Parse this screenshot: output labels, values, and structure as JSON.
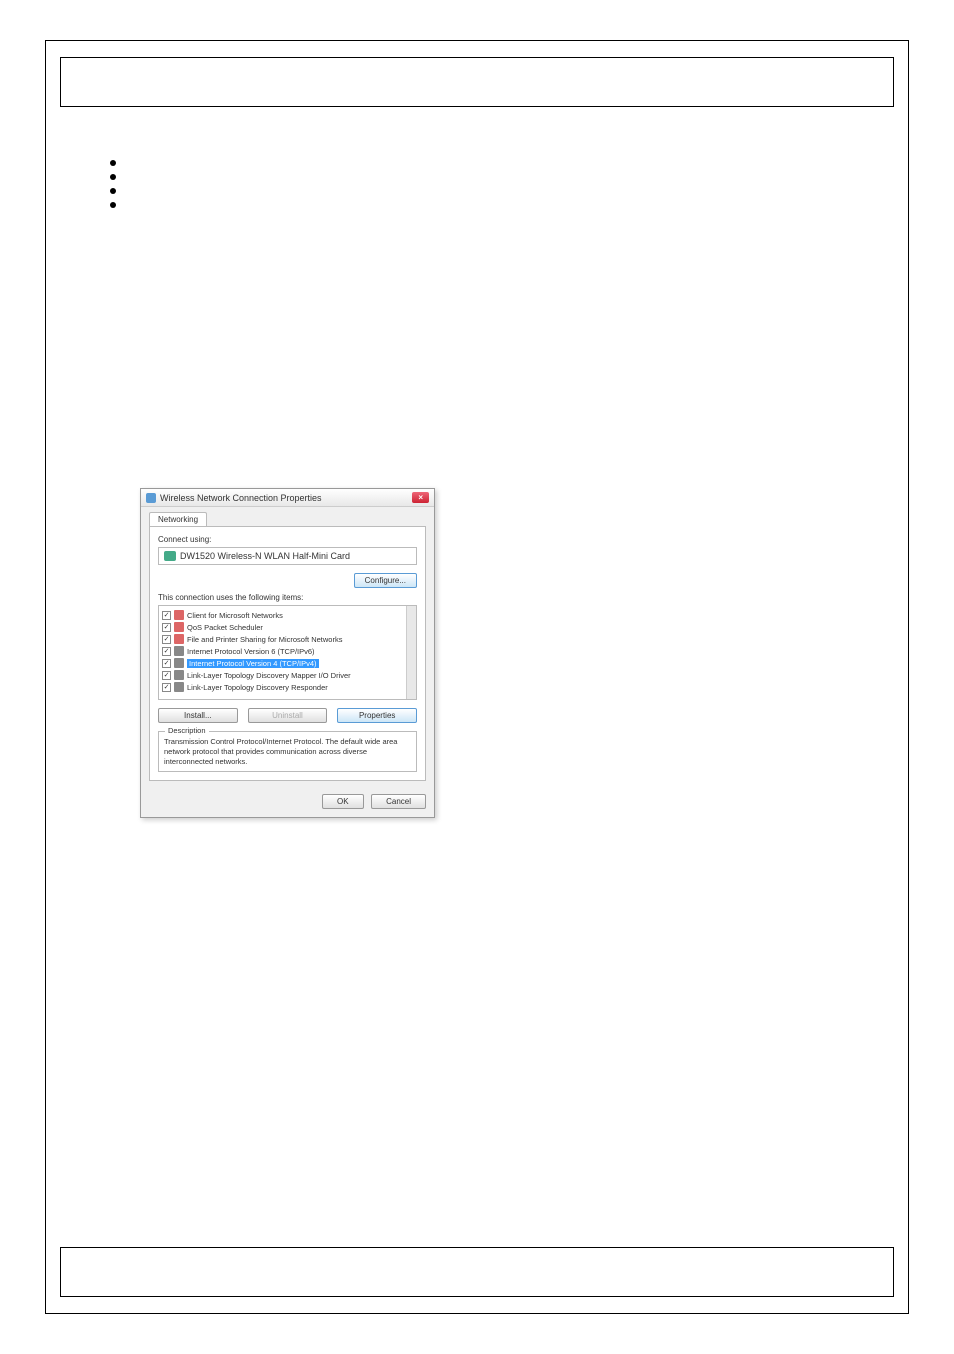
{
  "dialog": {
    "title": "Wireless Network Connection Properties",
    "closeGlyph": "×",
    "tab": "Networking",
    "connectUsingLabel": "Connect using:",
    "adapterName": "DW1520 Wireless-N WLAN Half-Mini Card",
    "configureButton": "Configure...",
    "itemsLabel": "This connection uses the following items:",
    "items": [
      {
        "label": "Client for Microsoft Networks",
        "iconClass": "icon-client",
        "selected": false
      },
      {
        "label": "QoS Packet Scheduler",
        "iconClass": "icon-qos",
        "selected": false
      },
      {
        "label": "File and Printer Sharing for Microsoft Networks",
        "iconClass": "icon-file",
        "selected": false
      },
      {
        "label": "Internet Protocol Version 6 (TCP/IPv6)",
        "iconClass": "icon-ipv6",
        "selected": false
      },
      {
        "label": "Internet Protocol Version 4 (TCP/IPv4)",
        "iconClass": "icon-ipv4",
        "selected": true
      },
      {
        "label": "Link-Layer Topology Discovery Mapper I/O Driver",
        "iconClass": "icon-lltd",
        "selected": false
      },
      {
        "label": "Link-Layer Topology Discovery Responder",
        "iconClass": "icon-lltd",
        "selected": false
      }
    ],
    "checkGlyph": "✓",
    "installButton": "Install...",
    "uninstallButton": "Uninstall",
    "propertiesButton": "Properties",
    "descriptionLabel": "Description",
    "descriptionText": "Transmission Control Protocol/Internet Protocol. The default wide area network protocol that provides communication across diverse interconnected networks.",
    "okButton": "OK",
    "cancelButton": "Cancel"
  }
}
